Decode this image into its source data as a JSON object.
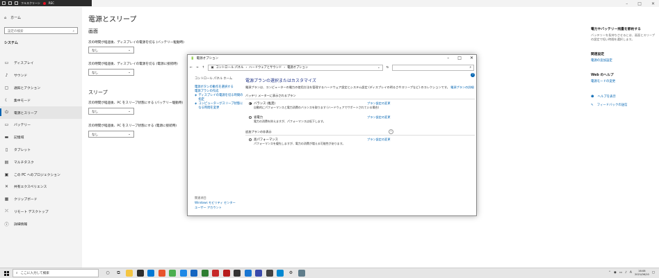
{
  "recbar": {
    "label": "フルスクリーン",
    "rec": "REC"
  },
  "window_controls": [
    "–",
    "□",
    "✕"
  ],
  "sidebar": {
    "home": "ホーム",
    "search_placeholder": "設定の検索",
    "section": "システム",
    "items": [
      {
        "label": "ディスプレイ",
        "icon": "display-icon"
      },
      {
        "label": "サウンド",
        "icon": "sound-icon"
      },
      {
        "label": "通知とアクション",
        "icon": "notification-icon"
      },
      {
        "label": "集中モード",
        "icon": "moon-icon"
      },
      {
        "label": "電源とスリープ",
        "icon": "power-icon",
        "active": true
      },
      {
        "label": "バッテリー",
        "icon": "battery-icon"
      },
      {
        "label": "記憶域",
        "icon": "storage-icon"
      },
      {
        "label": "タブレット",
        "icon": "tablet-icon"
      },
      {
        "label": "マルチタスク",
        "icon": "multitask-icon"
      },
      {
        "label": "この PC へのプロジェクション",
        "icon": "projection-icon"
      },
      {
        "label": "共有エクスペリエンス",
        "icon": "share-icon"
      },
      {
        "label": "クリップボード",
        "icon": "clipboard-icon"
      },
      {
        "label": "リモート デスクトップ",
        "icon": "remote-icon"
      },
      {
        "label": "詳細情報",
        "icon": "info-icon"
      }
    ]
  },
  "main": {
    "title": "電源とスリープ",
    "screen_heading": "画面",
    "screen_battery_label": "次の時間が経過後、ディスプレイの電源を切る (バッテリー駆動時)",
    "screen_battery_value": "なし",
    "screen_plugged_label": "次の時間が経過後、ディスプレイの電源を切る (電源に接続時)",
    "screen_plugged_value": "なし",
    "sleep_heading": "スリープ",
    "sleep_battery_label": "次の時間が経過後、PC をスリープ状態にする (バッテリー駆動時)",
    "sleep_battery_value": "なし",
    "sleep_plugged_label": "次の時間が経過後、PC をスリープ状態にする (電源に接続時)",
    "sleep_plugged_value": "なし"
  },
  "right_col": {
    "battery_heading": "電力やバッテリー残量を節約する",
    "battery_text": "バッテリーを長持ちさせるには、画面とスリープの設定で短い時間を選択します。",
    "related_heading": "関連設定",
    "related_link": "電源の追加設定",
    "web_heading": "Web のヘルプ",
    "web_link": "電源モードの変更",
    "help_link": "ヘルプを表示",
    "feedback_link": "フィードバックの送信"
  },
  "dialog": {
    "title": "電源オプション",
    "breadcrumb": [
      "コントロール パネル",
      "ハードウェアとサウンド",
      "電源オプション"
    ],
    "left_home": "コントロール パネル ホーム",
    "left_links": [
      "電源ボタンの動作を選択する",
      "電源プランの作成",
      "ディスプレイの電源を切る時間の指定",
      "コンピューターがスリープ状態になる時間を変更"
    ],
    "bottom_label": "関連項目",
    "bottom_links": [
      "Windows モビリティ センター",
      "ユーザー アカウント"
    ],
    "heading": "電源プランの選択またはカスタマイズ",
    "desc": "電源プランは、コンピューターの電力の使用方法を管理するハードウェア設定とシステム設定 (ディスプレイの明るさやスリープなど) のコレクションです。",
    "desc_link": "電源プランの詳細",
    "group_label": "バッテリ メーターに表示されるプラン",
    "plans": [
      {
        "name": "バランス (推奨)",
        "desc": "自動的にパフォーマンスと電力消費のバランスを取ります (ハードウェアでサポートされている場合)",
        "selected": true,
        "change": "プラン設定の変更"
      },
      {
        "name": "省電力",
        "desc": "電力の消費を抑えますが、パフォーマンスは低下します。",
        "selected": false,
        "change": "プラン設定の変更"
      }
    ],
    "extra_label": "追加プランの非表示",
    "extra_plans": [
      {
        "name": "高パフォーマンス",
        "desc": "パフォーマンスを優先しますが、電力の消費が増える可能性があります。",
        "selected": false,
        "change": "プラン設定の変更"
      }
    ]
  },
  "taskbar": {
    "search_placeholder": "ここに入力して検索",
    "tray_lang": "A",
    "time": "16:08",
    "date": "2021/06/10"
  }
}
